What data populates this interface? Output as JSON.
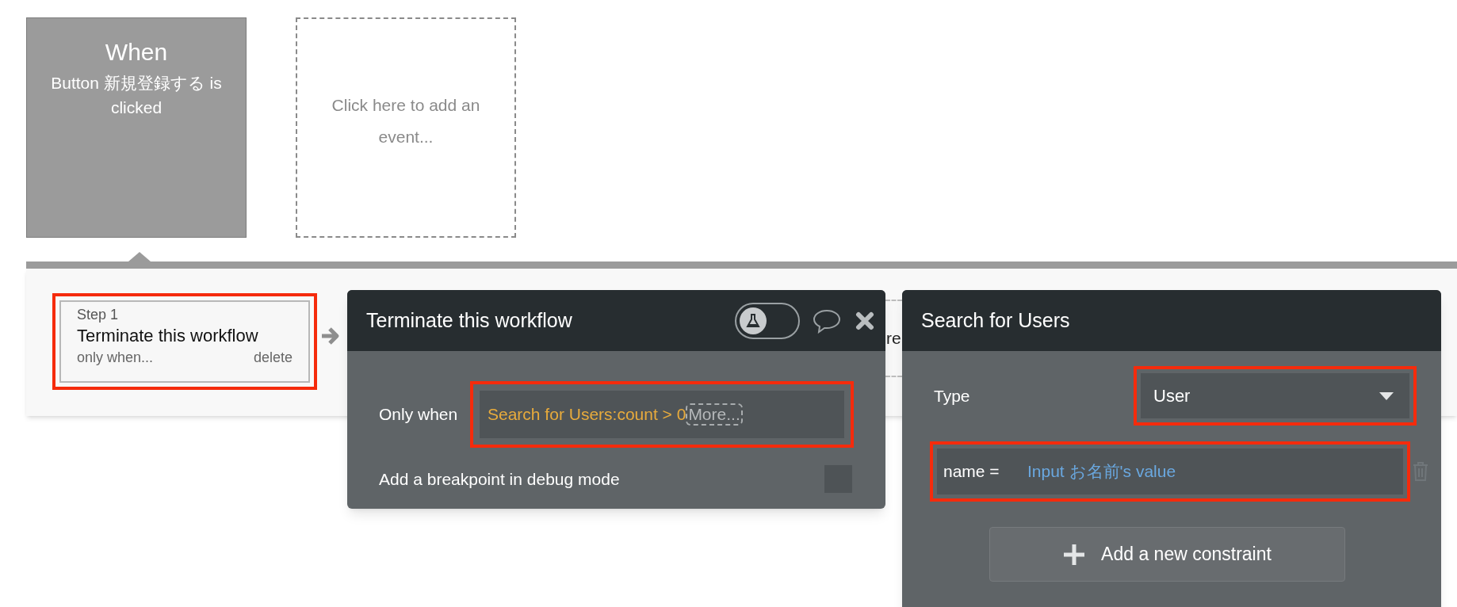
{
  "events": [
    {
      "kind": "event",
      "title": "When",
      "description": "Button 新規登録する is clicked",
      "selected": true
    },
    {
      "kind": "placeholder",
      "description": "Click here to add an event...",
      "selected": false
    }
  ],
  "steps": [
    {
      "label": "Step 1",
      "action": "Terminate this workflow",
      "condition_link": "only when...",
      "delete_link": "delete",
      "highlighted": true
    }
  ],
  "covered_text": "re",
  "action_panel": {
    "title": "Terminate this workflow",
    "debug_toggle": {
      "on": false
    },
    "fields": [
      {
        "label": "Only when",
        "value": "Search for Users:count > 0",
        "more": "More...",
        "highlighted": true
      }
    ],
    "breakpoint": {
      "label": "Add a breakpoint in debug mode",
      "checked": false
    }
  },
  "search_panel": {
    "title": "Search for Users",
    "type": {
      "label": "Type",
      "value": "User",
      "highlighted": true
    },
    "constraints": [
      {
        "field": "name =",
        "value": "Input お名前's value",
        "highlighted": true
      }
    ],
    "add_button": "Add a new constraint"
  }
}
